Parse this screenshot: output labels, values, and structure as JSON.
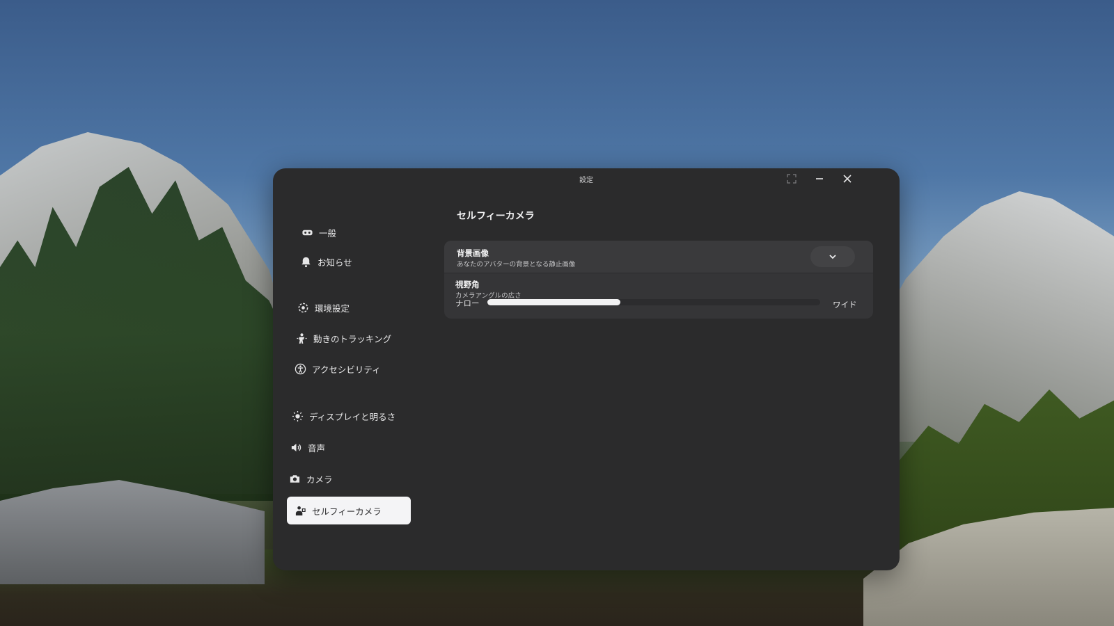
{
  "window": {
    "title": "設定"
  },
  "sidebar": {
    "items": [
      {
        "label": "一般",
        "icon": "vr-headset-icon"
      },
      {
        "label": "お知らせ",
        "icon": "bell-icon"
      },
      {
        "label": "環境設定",
        "icon": "environment-icon"
      },
      {
        "label": "動きのトラッキング",
        "icon": "motion-tracking-icon"
      },
      {
        "label": "アクセシビリティ",
        "icon": "accessibility-icon"
      },
      {
        "label": "ディスプレイと明るさ",
        "icon": "sun-icon"
      },
      {
        "label": "音声",
        "icon": "speaker-icon"
      },
      {
        "label": "カメラ",
        "icon": "camera-icon"
      },
      {
        "label": "セルフィーカメラ",
        "icon": "selfie-camera-icon",
        "active": true
      }
    ]
  },
  "content": {
    "title": "セルフィーカメラ",
    "background_image": {
      "title": "背景画像",
      "subtitle": "あなたのアバターの背景となる静止画像"
    },
    "field_of_view": {
      "title": "視野角",
      "subtitle": "カメラアングルの広さ",
      "min_label": "ナロー",
      "max_label": "ワイド",
      "value_fraction": 0.4
    }
  },
  "colors": {
    "window_bg": "#2b2b2c",
    "card_bg": "#353537",
    "active_item_bg": "#f4f4f6",
    "slider_fill": "#f2f2f3"
  }
}
